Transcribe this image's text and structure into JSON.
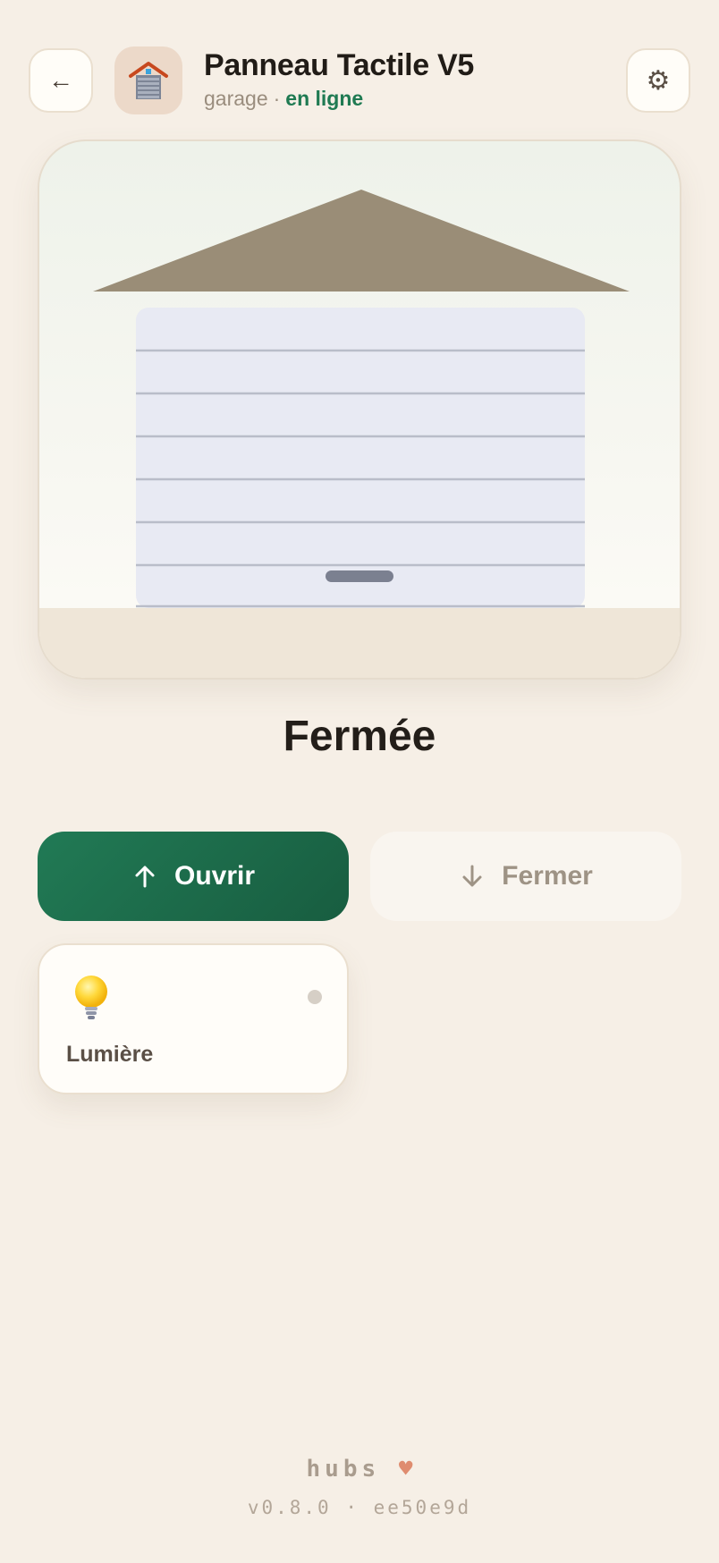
{
  "header": {
    "back_label": "←",
    "title": "Panneau Tactile V5",
    "subtitle_room": "garage",
    "subtitle_separator": "·",
    "subtitle_status": "en ligne",
    "settings_label": "⚙",
    "app_icon": "garage-icon"
  },
  "garage": {
    "state": "Fermée",
    "door_position_percent_open": 0
  },
  "actions": {
    "open_label": "Ouvrir",
    "open_icon": "arrow-up-icon",
    "close_label": "Fermer",
    "close_icon": "arrow-down-icon"
  },
  "tiles": [
    {
      "label": "Lumière",
      "icon": "lightbulb-icon",
      "on": false
    }
  ],
  "footer": {
    "brand": "hubs",
    "heart": "♥",
    "version": "v0.8.0 · ee50e9d"
  },
  "colors": {
    "background": "#f6efe6",
    "accent": "#1f7a52",
    "roof": "#9a8d77",
    "door": "#e8eaf3"
  }
}
